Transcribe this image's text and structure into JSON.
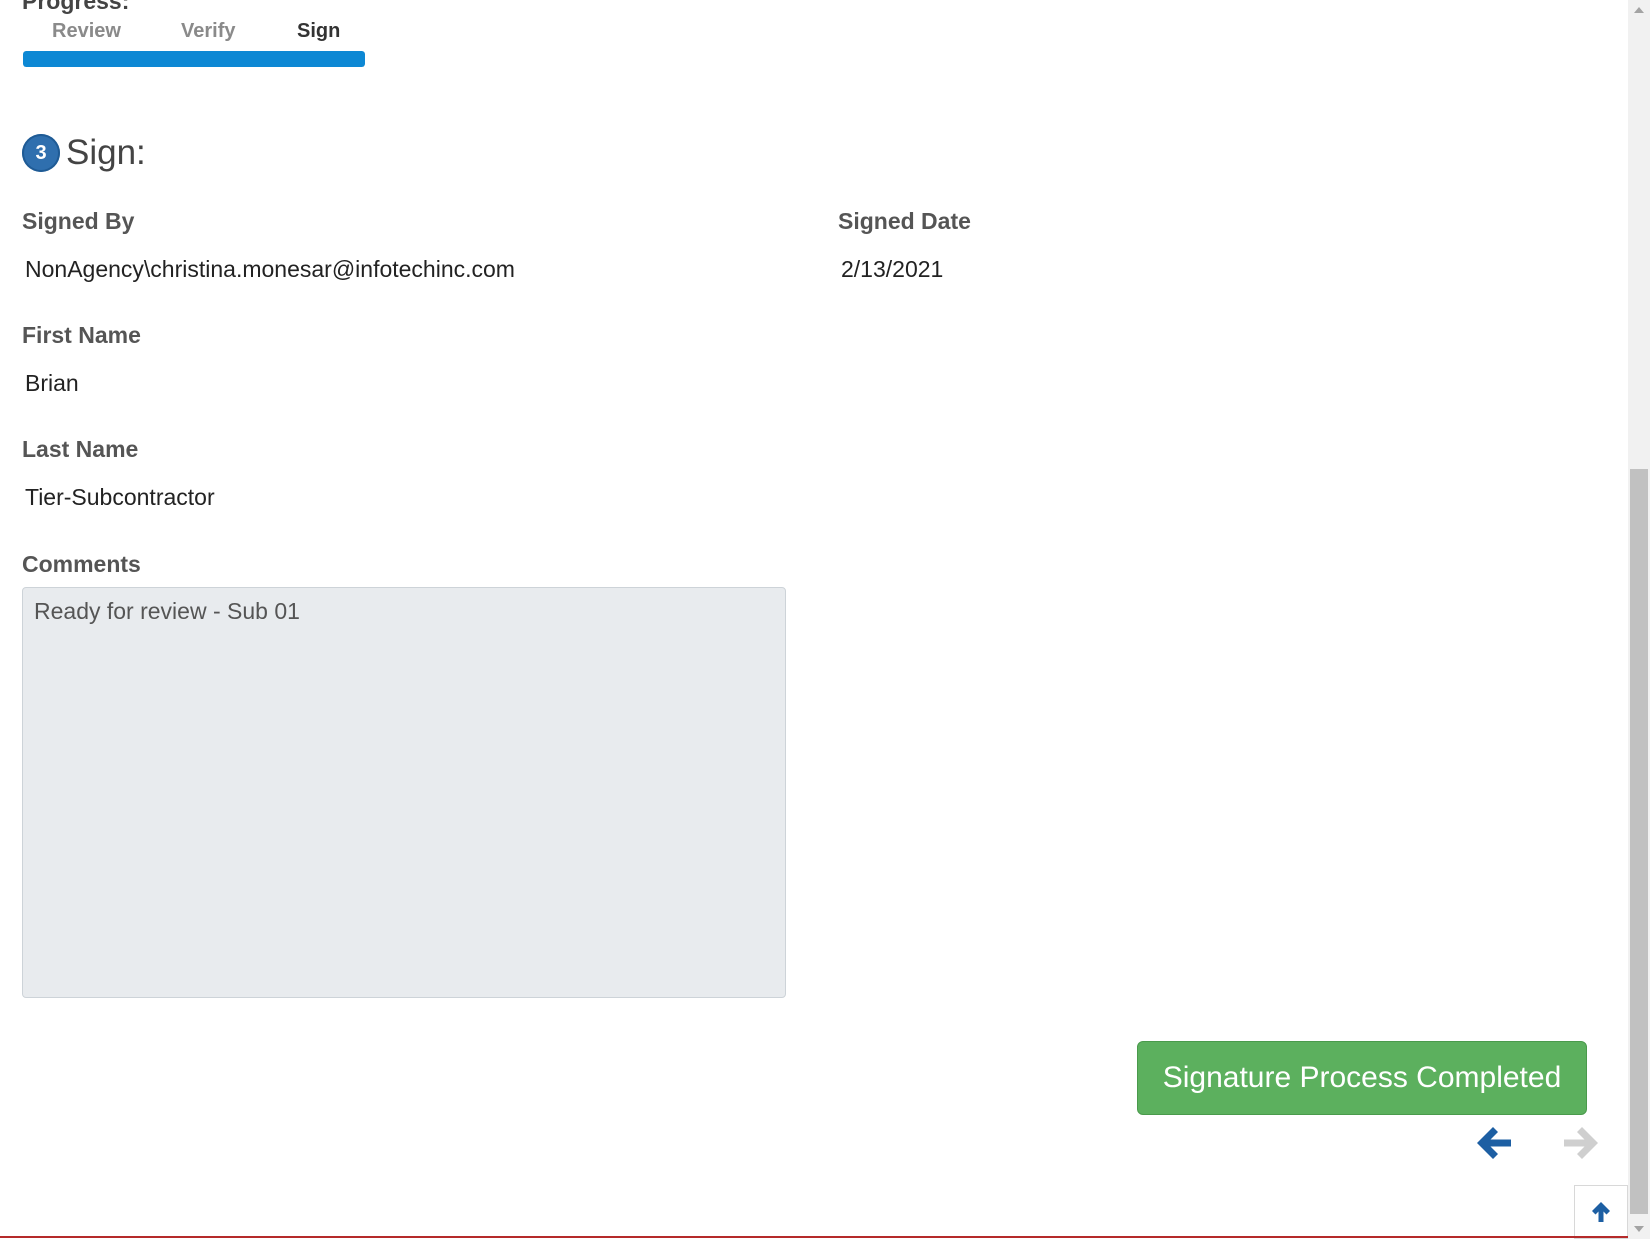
{
  "progress": {
    "heading": "Progress:",
    "steps": [
      "Review",
      "Verify",
      "Sign"
    ],
    "value_percent": 100,
    "bar_color": "#0d88d4"
  },
  "section": {
    "step_number": "3",
    "title": "Sign:"
  },
  "fields": {
    "signed_by": {
      "label": "Signed By",
      "value": "NonAgency\\christina.monesar@infotechinc.com"
    },
    "signed_date": {
      "label": "Signed Date",
      "value": "2/13/2021"
    },
    "first_name": {
      "label": "First Name",
      "value": "Brian"
    },
    "last_name": {
      "label": "Last Name",
      "value": "Tier-Subcontractor"
    },
    "comments": {
      "label": "Comments",
      "value": "Ready for review - Sub 01"
    }
  },
  "actions": {
    "complete_label": "Signature Process Completed",
    "complete_color": "#5cb05e",
    "prev_icon": "arrow-left-icon",
    "next_icon": "arrow-right-icon",
    "to_top_icon": "arrow-up-icon"
  }
}
